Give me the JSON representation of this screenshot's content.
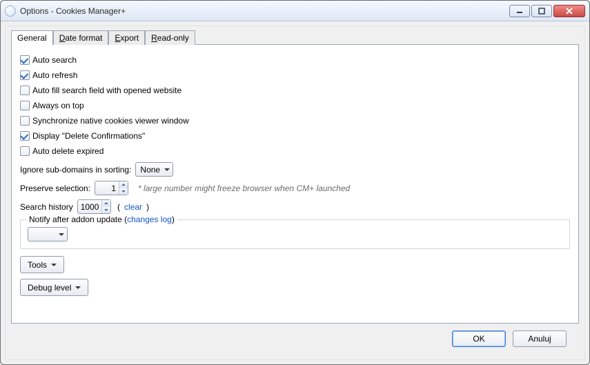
{
  "titlebar": {
    "title": "Options - Cookies Manager+"
  },
  "tabs": {
    "general": "General",
    "dateformat_pre": "D",
    "dateformat_rest": "ate format",
    "export_pre": "E",
    "export_rest": "xport",
    "readonly_pre": "R",
    "readonly_rest": "ead-only"
  },
  "checkboxes": [
    {
      "label": "Auto search",
      "checked": true
    },
    {
      "label": "Auto refresh",
      "checked": true
    },
    {
      "label": "Auto fill search field with opened website",
      "checked": false
    },
    {
      "label": "Always on top",
      "checked": false
    },
    {
      "label": "Synchronize native cookies viewer window",
      "checked": false
    },
    {
      "label": "Display \"Delete Confirmations\"",
      "checked": true
    },
    {
      "label": "Auto delete expired",
      "checked": false
    }
  ],
  "ignore": {
    "label": "Ignore sub-domains in sorting:",
    "value": "None"
  },
  "preserve": {
    "label": "Preserve selection:",
    "value": "1",
    "note": "* large number might freeze browser when CM+ launched"
  },
  "history": {
    "label": "Search history",
    "value": "1000",
    "clear": "clear"
  },
  "notify": {
    "legend_pre": "Notify after addon update (",
    "legend_link": "changes log",
    "legend_post": ")"
  },
  "buttons": {
    "tools": "Tools",
    "debug": "Debug level"
  },
  "footer": {
    "ok": "OK",
    "cancel": "Anuluj"
  }
}
